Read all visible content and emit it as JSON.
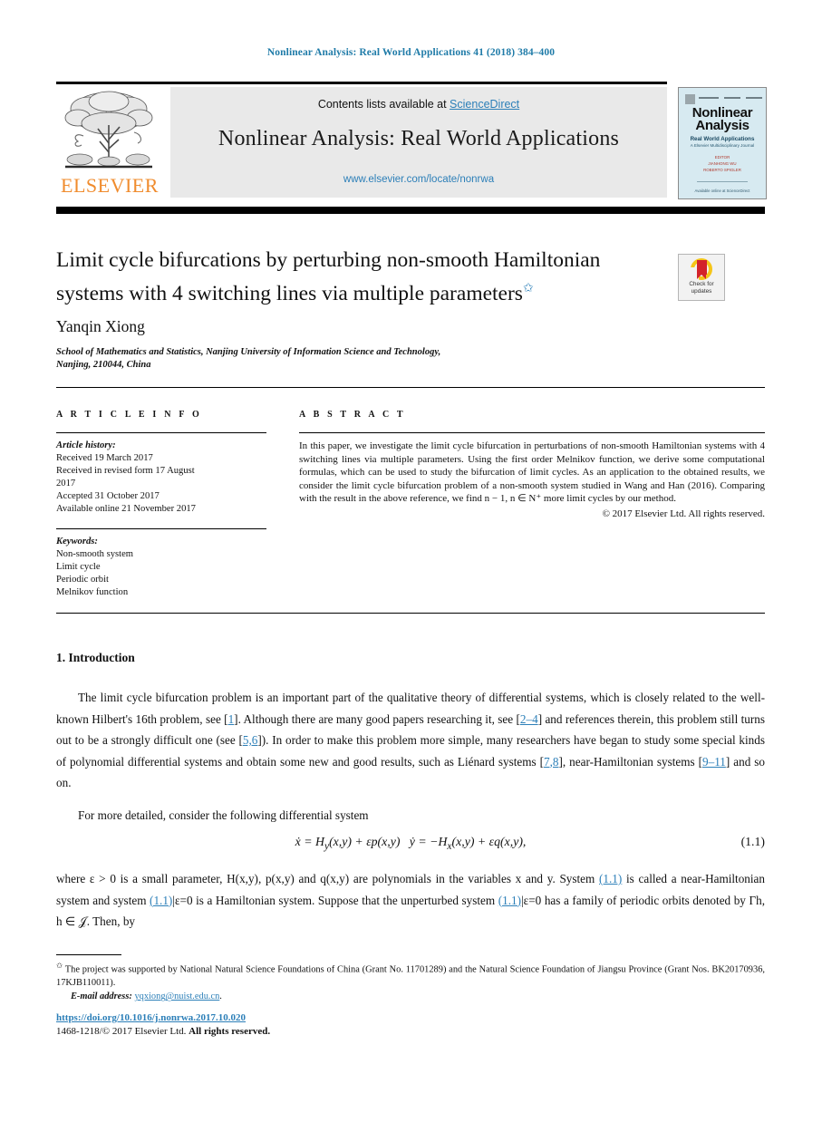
{
  "running_head": "Nonlinear Analysis: Real World Applications 41 (2018) 384–400",
  "masthead": {
    "contents_prefix": "Contents lists available at ",
    "sciencedirect": "ScienceDirect",
    "journal_title": "Nonlinear Analysis: Real World Applications",
    "journal_url": "www.elsevier.com/locate/nonrwa",
    "publisher_logo_text": "ELSEVIER"
  },
  "cover": {
    "name_line1": "Nonlinear",
    "name_line2": "Analysis",
    "subtitle": "Real World Applications",
    "subtitle2": "A Elsevier Multidisciplinary Journal",
    "editors_line1": "EDITOR",
    "editors_line2": "JIANHONG WU",
    "editors_line3": "ROBERTO SPIGLER",
    "footer": "Available online at\nScienceDirect"
  },
  "article": {
    "title": "Limit cycle bifurcations by perturbing non-smooth Hamiltonian systems with 4 switching lines via multiple parameters",
    "title_marker": "✩",
    "author": "Yanqin Xiong",
    "affiliation_line1": "School of Mathematics and Statistics, Nanjing University of Information Science and Technology,",
    "affiliation_line2": "Nanjing, 210044, China"
  },
  "crossmark": {
    "label_line1": "Check for",
    "label_line2": "updates",
    "ring_color": "#F5C518",
    "book_color": "#D3232A"
  },
  "info": {
    "heading": "A R T I C L E   I N F O",
    "history_label": "Article history:",
    "history": [
      "Received 19 March 2017",
      "Received in revised form 17 August",
      "2017",
      "Accepted 31 October 2017",
      "Available online 21 November 2017"
    ],
    "keywords_label": "Keywords:",
    "keywords": [
      "Non-smooth system",
      "Limit cycle",
      "Periodic orbit",
      "Melnikov function"
    ]
  },
  "abstract": {
    "heading": "A B S T R A C T",
    "body": "In this paper, we investigate the limit cycle bifurcation in perturbations of non-smooth Hamiltonian systems with 4 switching lines via multiple parameters. Using the first order Melnikov function, we derive some computational formulas, which can be used to study the bifurcation of limit cycles. As an application to the obtained results, we consider the limit cycle bifurcation problem of a non-smooth system studied in Wang and Han (2016). Comparing with the result in the above reference, we find n − 1, n ∈ N⁺ more limit cycles by our method.",
    "copyright": "© 2017 Elsevier Ltd. All rights reserved."
  },
  "section": {
    "heading": "1. Introduction",
    "para1_a": "The limit cycle bifurcation problem is an important part of the qualitative theory of differential systems, which is closely related to the well-known Hilbert's 16th problem, see [",
    "ref1": "1",
    "para1_b": "]. Although there are many good papers researching it, see [",
    "ref2": "2–4",
    "para1_c": "] and references therein, this problem still turns out to be a strongly difficult one (see [",
    "ref3": "5,6",
    "para1_d": "]). In order to make this problem more simple, many researchers have began to study some special kinds of polynomial differential systems and obtain some new and good results, such as Liénard systems [",
    "ref4": "7,8",
    "para1_e": "], near-Hamiltonian systems [",
    "ref5": "9–11",
    "para1_f": "] and so on.",
    "para2": "For more detailed, consider the following differential system",
    "equation": "ẋ = H_y(x,y) + εp(x,y)   ẏ = −H_x(x,y) + εq(x,y),",
    "equation_number": "(1.1)",
    "para3_a": "where ε > 0 is a small parameter, H(x,y), p(x,y) and q(x,y) are polynomials in the variables x and y. System ",
    "eqref1": "(1.1)",
    "para3_b": " is called a near-Hamiltonian system and system ",
    "eqref2": "(1.1)",
    "para3_c": "|ε=0 is a Hamiltonian system. Suppose that the unperturbed system ",
    "eqref3": "(1.1)",
    "para3_d": "|ε=0 has a family of periodic orbits denoted by Γh, h ∈ 𝒥. Then, by"
  },
  "footnote": {
    "star": "✩",
    "text": "The project was supported by National Natural Science Foundations of China (Grant No. 11701289) and the Natural Science Foundation of Jiangsu Province (Grant Nos. BK20170936, 17KJB110011).",
    "email_label": "E-mail address:",
    "email": "yqxiong@nuist.edu.cn",
    "email_period": "."
  },
  "imprint": {
    "doi": "https://doi.org/10.1016/j.nonrwa.2017.10.020",
    "issn_prefix": "1468-1218/",
    "issn_copy": "© 2017 Elsevier Ltd. ",
    "issn_rights": "All rights reserved."
  },
  "colors": {
    "link": "#2C7FB8",
    "running_head": "#1F7BA8",
    "elsevier_orange": "#F08C2E",
    "cover_bg": "#D7EAF1",
    "masthead_bg": "#E9E9E9"
  }
}
